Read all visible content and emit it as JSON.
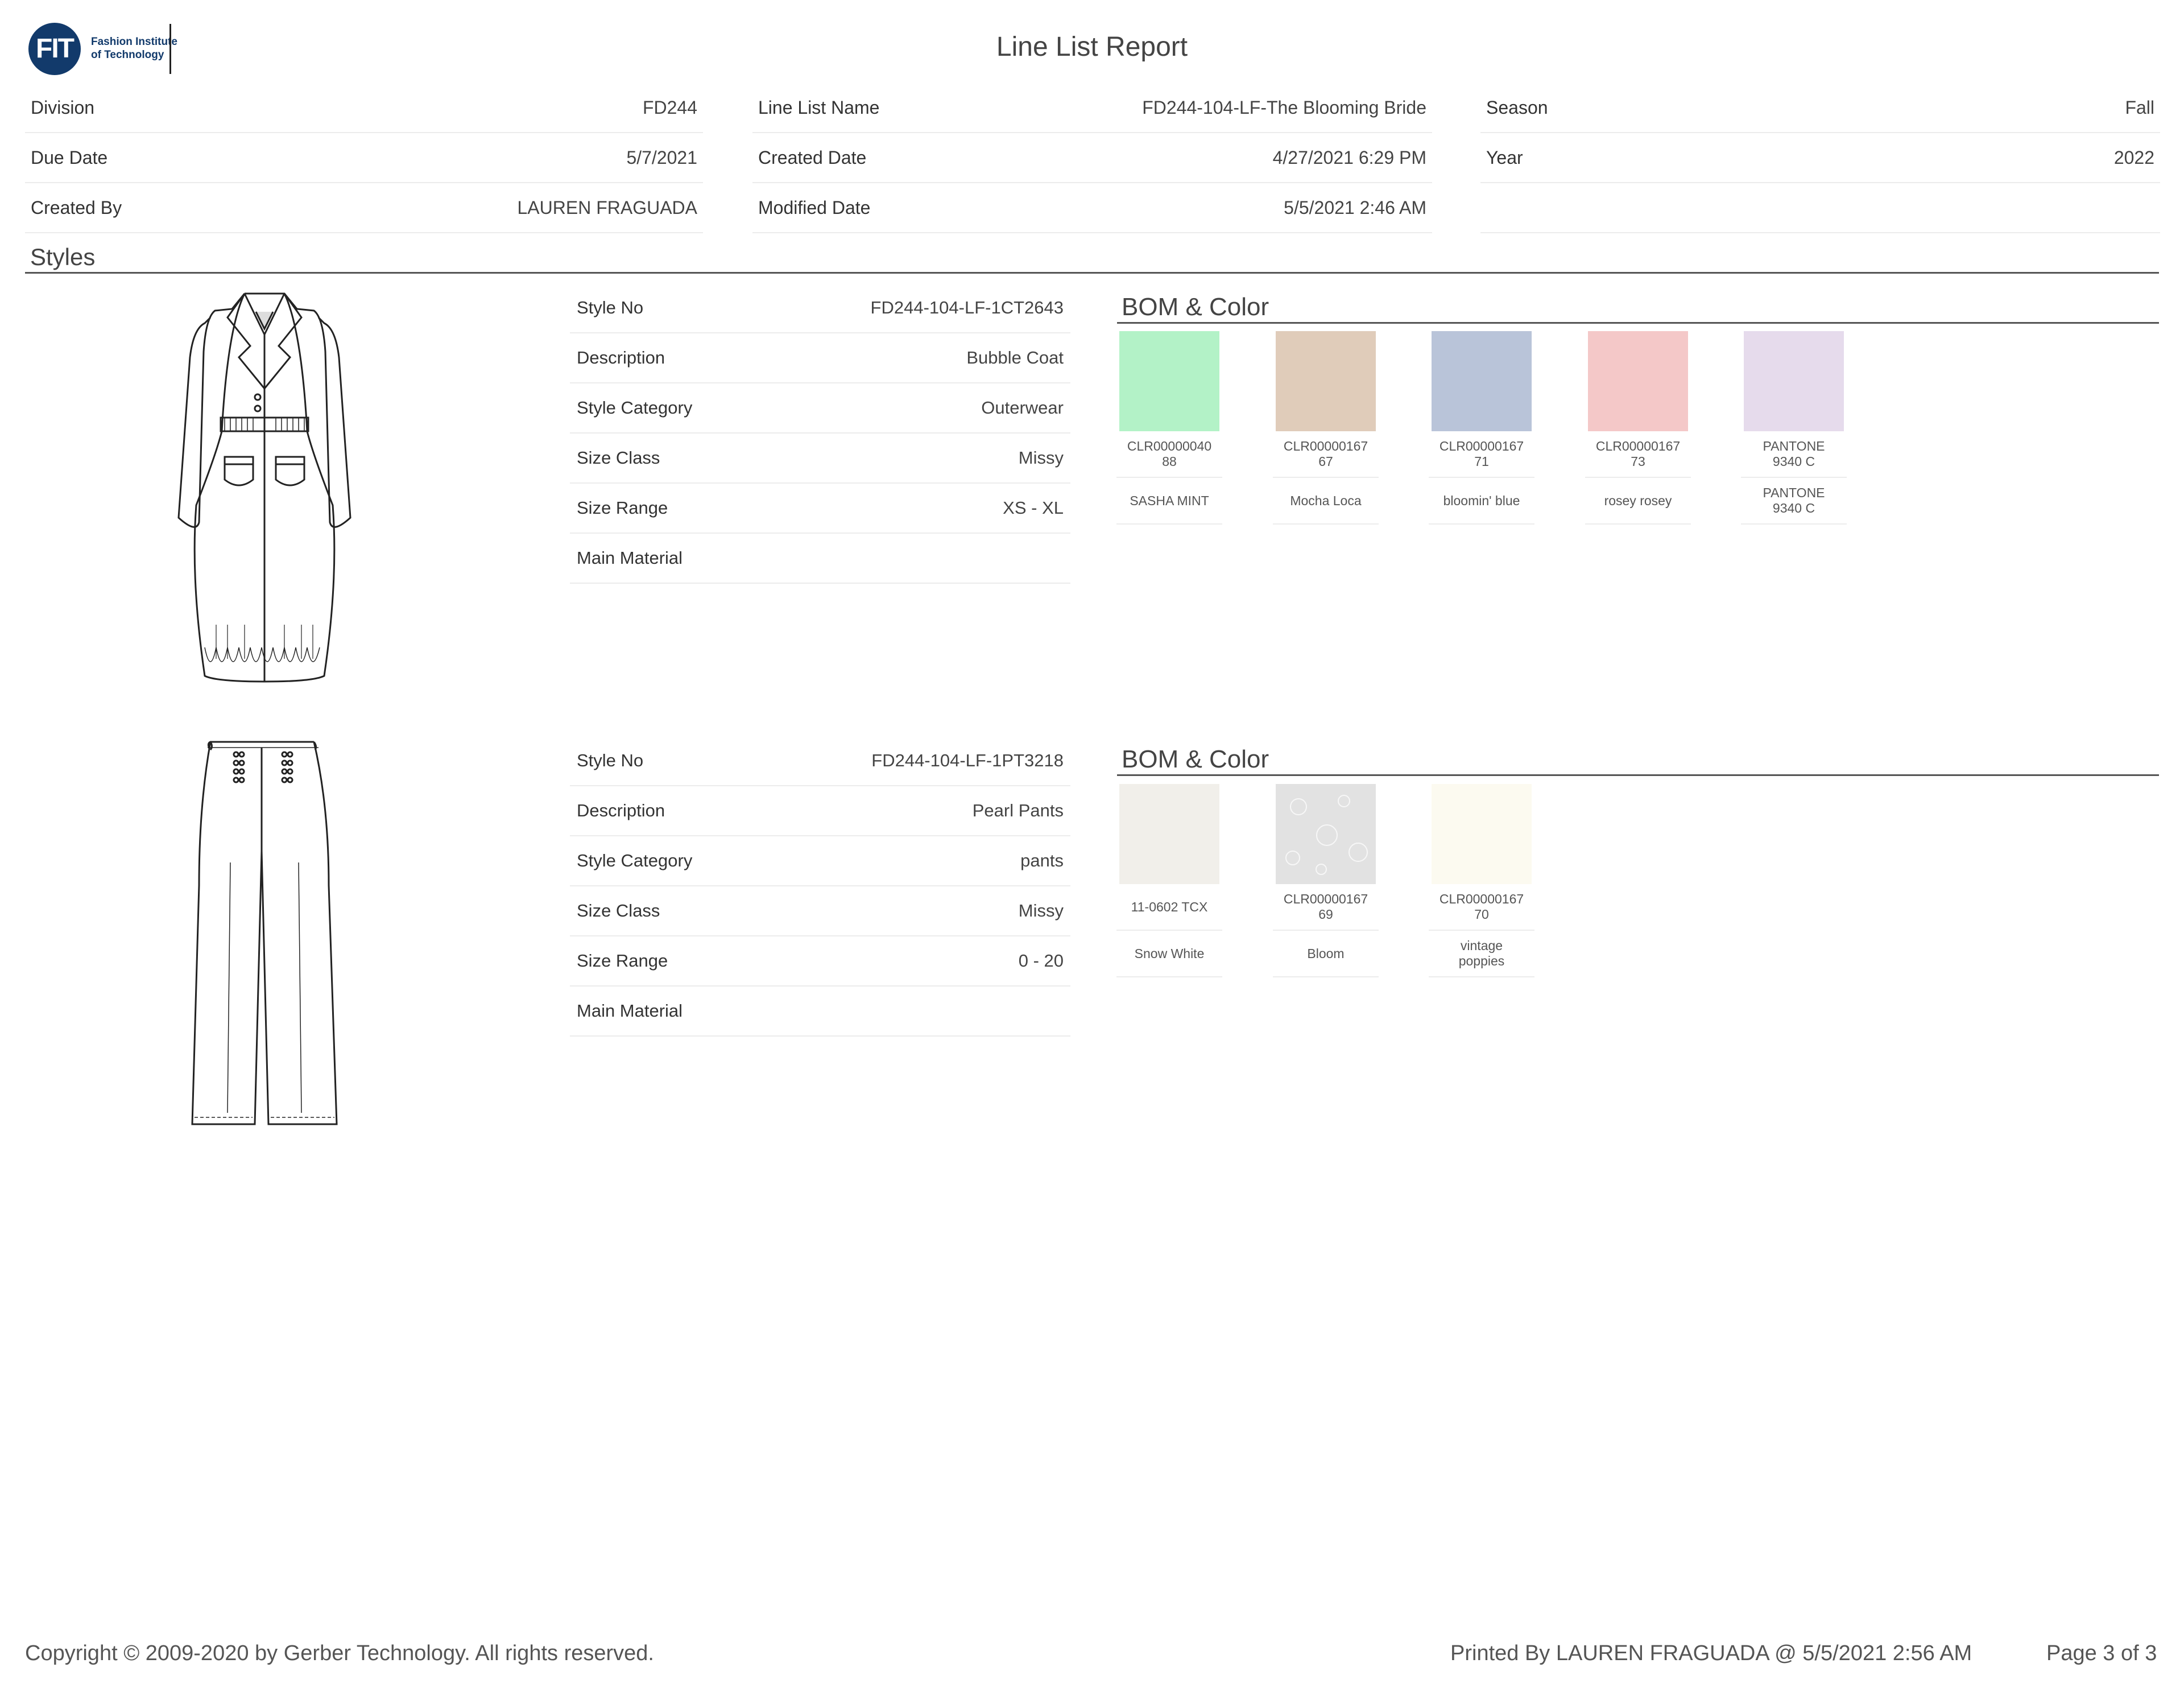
{
  "header": {
    "logo_text": "FIT",
    "logo_line1": "Fashion Institute",
    "logo_line2": "of Technology",
    "title": "Line List Report"
  },
  "info": {
    "col1": [
      {
        "label": "Division",
        "value": "FD244"
      },
      {
        "label": "Due Date",
        "value": "5/7/2021"
      },
      {
        "label": "Created By",
        "value": "LAUREN FRAGUADA"
      }
    ],
    "col2": [
      {
        "label": "Line List Name",
        "value": "FD244-104-LF-The Blooming Bride"
      },
      {
        "label": "Created Date",
        "value": "4/27/2021 6:29 PM"
      },
      {
        "label": "Modified Date",
        "value": "5/5/2021 2:46 AM"
      }
    ],
    "col3": [
      {
        "label": "Season",
        "value": "Fall"
      },
      {
        "label": "Year",
        "value": "2022"
      }
    ]
  },
  "section_title": "Styles",
  "styles": [
    {
      "sketch": "coat-sketch",
      "rows": [
        {
          "label": "Style No",
          "value": "FD244-104-LF-1CT2643"
        },
        {
          "label": "Description",
          "value": "Bubble Coat"
        },
        {
          "label": "Style Category",
          "value": "Outerwear"
        },
        {
          "label": "Size Class",
          "value": "Missy"
        },
        {
          "label": "Size Range",
          "value": "XS - XL"
        },
        {
          "label": "Main Material",
          "value": ""
        }
      ],
      "bom_title": "BOM & Color",
      "colors": [
        {
          "code_a": "CLR00000040",
          "code_b": "88",
          "name_a": "SASHA MINT",
          "name_b": "",
          "color": "#b3f2c7"
        },
        {
          "code_a": "CLR00000167",
          "code_b": "67",
          "name_a": "Mocha Loca",
          "name_b": "",
          "color": "#e0ccba"
        },
        {
          "code_a": "CLR00000167",
          "code_b": "71",
          "name_a": "bloomin' blue",
          "name_b": "",
          "color": "#b9c4d9"
        },
        {
          "code_a": "CLR00000167",
          "code_b": "73",
          "name_a": "rosey rosey",
          "name_b": "",
          "color": "#f4c8c8"
        },
        {
          "code_a": "PANTONE",
          "code_b": "9340 C",
          "name_a": "PANTONE",
          "name_b": "9340 C",
          "color": "#e6dbec"
        }
      ]
    },
    {
      "sketch": "pants-sketch",
      "rows": [
        {
          "label": "Style No",
          "value": "FD244-104-LF-1PT3218"
        },
        {
          "label": "Description",
          "value": "Pearl Pants"
        },
        {
          "label": "Style Category",
          "value": "pants"
        },
        {
          "label": "Size Class",
          "value": "Missy"
        },
        {
          "label": "Size Range",
          "value": "0 - 20"
        },
        {
          "label": "Main Material",
          "value": ""
        }
      ],
      "bom_title": "BOM & Color",
      "colors": [
        {
          "code_a": "11-0602 TCX",
          "code_b": "",
          "name_a": "Snow White",
          "name_b": "",
          "color": "#f1efea"
        },
        {
          "code_a": "CLR00000167",
          "code_b": "69",
          "name_a": "Bloom",
          "name_b": "",
          "color": "#e2e2e2"
        },
        {
          "code_a": "CLR00000167",
          "code_b": "70",
          "name_a": "vintage",
          "name_b": "poppies",
          "color": "#fcfaf0"
        }
      ]
    }
  ],
  "footer": {
    "copyright": "Copyright © 2009-2020 by Gerber Technology. All rights reserved.",
    "printed_by": "Printed By LAUREN FRAGUADA @ 5/5/2021 2:56 AM",
    "page": "Page 3 of 3"
  }
}
